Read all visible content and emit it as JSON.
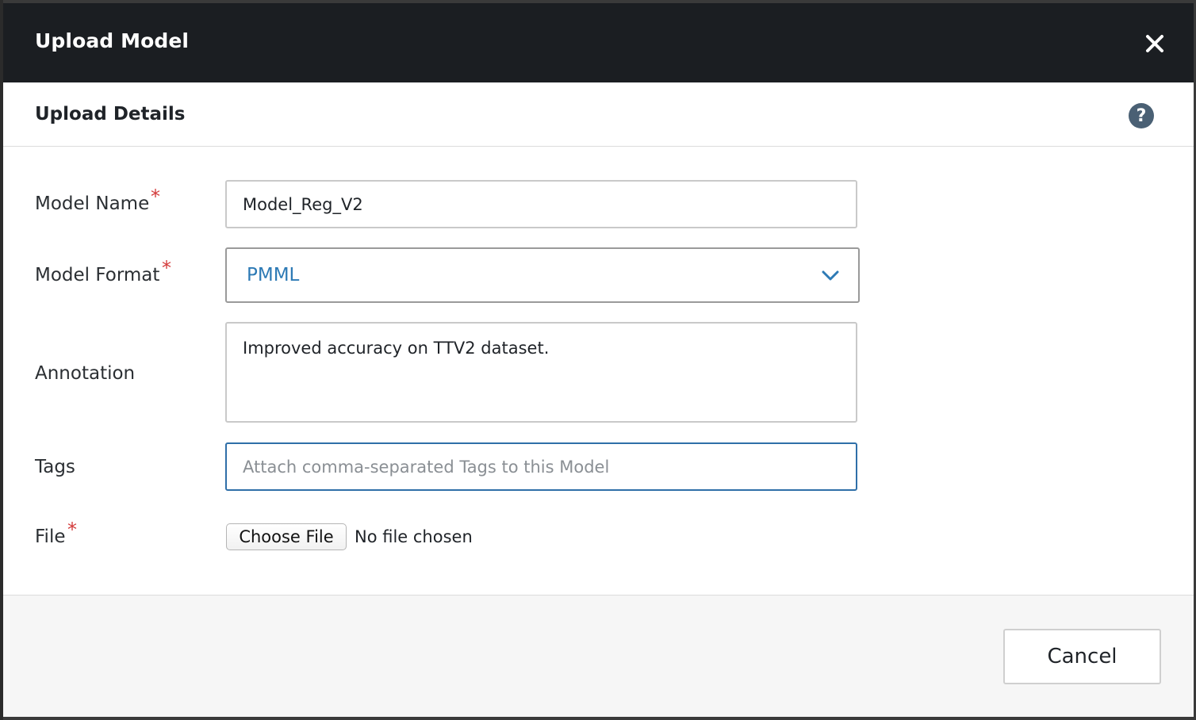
{
  "dialog": {
    "title": "Upload Model",
    "close_icon": "close-icon"
  },
  "section": {
    "title": "Upload Details",
    "help_icon": "?"
  },
  "form": {
    "required_mark": "*",
    "model_name": {
      "label": "Model Name",
      "value": "Model_Reg_V2",
      "required": true
    },
    "model_format": {
      "label": "Model Format",
      "value": "PMML",
      "required": true
    },
    "annotation": {
      "label": "Annotation",
      "value": "Improved accuracy on TTV2 dataset.",
      "required": false
    },
    "tags": {
      "label": "Tags",
      "value": "",
      "placeholder": "Attach comma-separated Tags to this Model",
      "required": false
    },
    "file": {
      "label": "File",
      "button_label": "Choose File",
      "status": "No file chosen",
      "required": true
    }
  },
  "footer": {
    "cancel_label": "Cancel"
  },
  "colors": {
    "titlebar": "#1b1e22",
    "accent": "#2d7ab5",
    "required": "#d33b3b",
    "help_icon_bg": "#4a6074"
  }
}
